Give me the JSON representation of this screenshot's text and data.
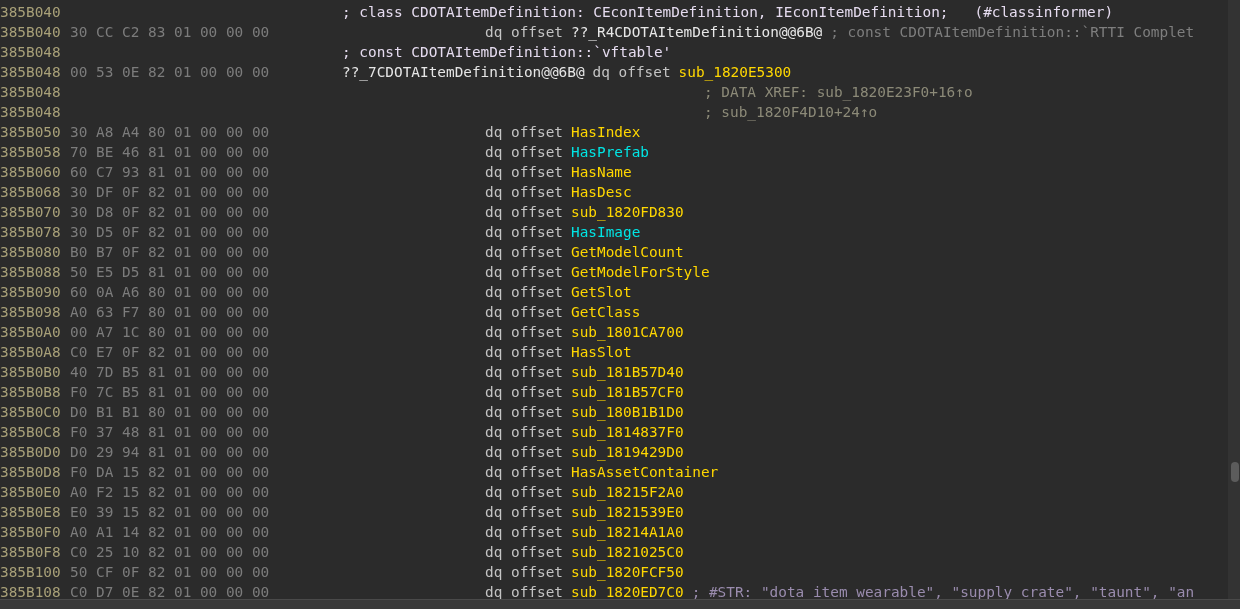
{
  "listing": {
    "rows": [
      {
        "address": "385B040",
        "kind": "comment",
        "comment": "; class CDOTAItemDefinition: CEconItemDefinition, IEconItemDefinition;   (#classinformer)"
      },
      {
        "address": "385B040",
        "bytes": "30 CC C2 83 01 00 00 00",
        "kind": "dq",
        "instruction": "dq offset",
        "target": "??_R4CDOTAItemDefinition@@6B@",
        "color": "#e8e8e8",
        "comment": "; const CDOTAItemDefinition::`RTTI Complet"
      },
      {
        "address": "385B048",
        "kind": "comment",
        "comment": "; const CDOTAItemDefinition::`vftable'"
      },
      {
        "address": "385B048",
        "bytes": "00 53 0E 82 01 00 00 00",
        "kind": "label",
        "label": "??_7CDOTAItemDefinition@@6B@",
        "instruction": "dq offset",
        "target": "sub_1820E5300",
        "color": "#ffd700"
      },
      {
        "address": "385B048",
        "kind": "xref",
        "comment": "; DATA XREF: sub_1820E23F0+16↑o"
      },
      {
        "address": "385B048",
        "kind": "xref",
        "comment": "; sub_1820F4D10+24↑o"
      },
      {
        "address": "385B050",
        "bytes": "30 A8 A4 80 01 00 00 00",
        "kind": "dq",
        "instruction": "dq offset",
        "target": "HasIndex",
        "color": "#ffd700"
      },
      {
        "address": "385B058",
        "bytes": "70 BE 46 81 01 00 00 00",
        "kind": "dq",
        "instruction": "dq offset",
        "target": "HasPrefab",
        "color": "#00e5e5"
      },
      {
        "address": "385B060",
        "bytes": "60 C7 93 81 01 00 00 00",
        "kind": "dq",
        "instruction": "dq offset",
        "target": "HasName",
        "color": "#ffd700"
      },
      {
        "address": "385B068",
        "bytes": "30 DF 0F 82 01 00 00 00",
        "kind": "dq",
        "instruction": "dq offset",
        "target": "HasDesc",
        "color": "#ffd700"
      },
      {
        "address": "385B070",
        "bytes": "30 D8 0F 82 01 00 00 00",
        "kind": "dq",
        "instruction": "dq offset",
        "target": "sub_1820FD830",
        "color": "#ffd700"
      },
      {
        "address": "385B078",
        "bytes": "30 D5 0F 82 01 00 00 00",
        "kind": "dq",
        "instruction": "dq offset",
        "target": "HasImage",
        "color": "#00e5e5"
      },
      {
        "address": "385B080",
        "bytes": "B0 B7 0F 82 01 00 00 00",
        "kind": "dq",
        "instruction": "dq offset",
        "target": "GetModelCount",
        "color": "#ffd700"
      },
      {
        "address": "385B088",
        "bytes": "50 E5 D5 81 01 00 00 00",
        "kind": "dq",
        "instruction": "dq offset",
        "target": "GetModelForStyle",
        "color": "#ffd700"
      },
      {
        "address": "385B090",
        "bytes": "60 0A A6 80 01 00 00 00",
        "kind": "dq",
        "instruction": "dq offset",
        "target": "GetSlot",
        "color": "#ffd700"
      },
      {
        "address": "385B098",
        "bytes": "A0 63 F7 80 01 00 00 00",
        "kind": "dq",
        "instruction": "dq offset",
        "target": "GetClass",
        "color": "#ffd700"
      },
      {
        "address": "385B0A0",
        "bytes": "00 A7 1C 80 01 00 00 00",
        "kind": "dq",
        "instruction": "dq offset",
        "target": "sub_1801CA700",
        "color": "#ffd700"
      },
      {
        "address": "385B0A8",
        "bytes": "C0 E7 0F 82 01 00 00 00",
        "kind": "dq",
        "instruction": "dq offset",
        "target": "HasSlot",
        "color": "#ffd700"
      },
      {
        "address": "385B0B0",
        "bytes": "40 7D B5 81 01 00 00 00",
        "kind": "dq",
        "instruction": "dq offset",
        "target": "sub_181B57D40",
        "color": "#ffd700"
      },
      {
        "address": "385B0B8",
        "bytes": "F0 7C B5 81 01 00 00 00",
        "kind": "dq",
        "instruction": "dq offset",
        "target": "sub_181B57CF0",
        "color": "#ffd700"
      },
      {
        "address": "385B0C0",
        "bytes": "D0 B1 B1 80 01 00 00 00",
        "kind": "dq",
        "instruction": "dq offset",
        "target": "sub_180B1B1D0",
        "color": "#ffd700"
      },
      {
        "address": "385B0C8",
        "bytes": "F0 37 48 81 01 00 00 00",
        "kind": "dq",
        "instruction": "dq offset",
        "target": "sub_1814837F0",
        "color": "#ffd700"
      },
      {
        "address": "385B0D0",
        "bytes": "D0 29 94 81 01 00 00 00",
        "kind": "dq",
        "instruction": "dq offset",
        "target": "sub_1819429D0",
        "color": "#ffd700"
      },
      {
        "address": "385B0D8",
        "bytes": "F0 DA 15 82 01 00 00 00",
        "kind": "dq",
        "instruction": "dq offset",
        "target": "HasAssetContainer",
        "color": "#ffd700"
      },
      {
        "address": "385B0E0",
        "bytes": "A0 F2 15 82 01 00 00 00",
        "kind": "dq",
        "instruction": "dq offset",
        "target": "sub_18215F2A0",
        "color": "#ffd700"
      },
      {
        "address": "385B0E8",
        "bytes": "E0 39 15 82 01 00 00 00",
        "kind": "dq",
        "instruction": "dq offset",
        "target": "sub_1821539E0",
        "color": "#ffd700"
      },
      {
        "address": "385B0F0",
        "bytes": "A0 A1 14 82 01 00 00 00",
        "kind": "dq",
        "instruction": "dq offset",
        "target": "sub_18214A1A0",
        "color": "#ffd700"
      },
      {
        "address": "385B0F8",
        "bytes": "C0 25 10 82 01 00 00 00",
        "kind": "dq",
        "instruction": "dq offset",
        "target": "sub_1821025C0",
        "color": "#ffd700"
      },
      {
        "address": "385B100",
        "bytes": "50 CF 0F 82 01 00 00 00",
        "kind": "dq",
        "instruction": "dq offset",
        "target": "sub_1820FCF50",
        "color": "#ffd700"
      },
      {
        "address": "385B108",
        "bytes": "C0 D7 0E 82 01 00 00 00",
        "kind": "dq",
        "instruction": "dq offset",
        "target": "sub_1820ED7C0",
        "color": "#ffd700",
        "comment": "; #STR: \"dota item wearable\", \"supply crate\", \"taunt\", \"an"
      }
    ]
  }
}
